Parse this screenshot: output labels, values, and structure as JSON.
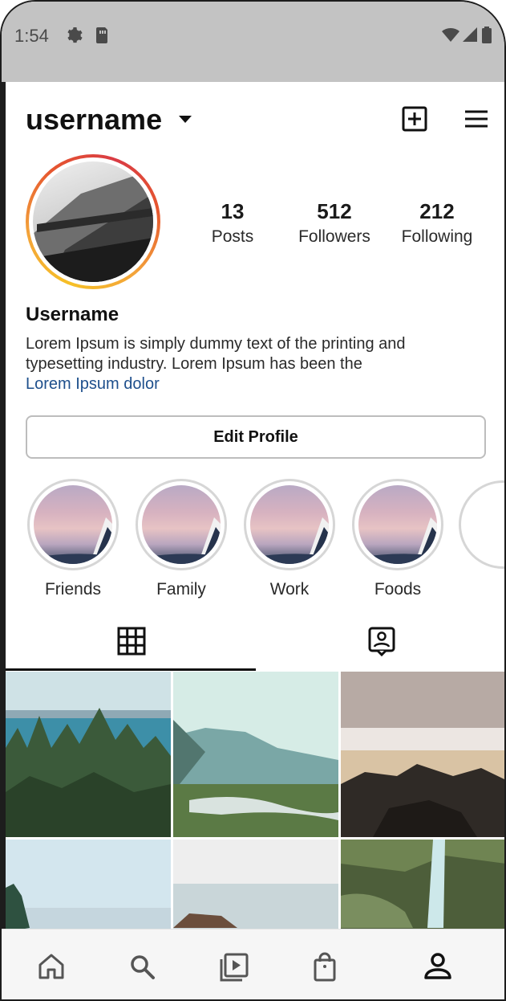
{
  "status_bar": {
    "time": "1:54",
    "icons": [
      "settings-icon",
      "sim-card-icon",
      "wifi-icon",
      "signal-icon",
      "battery-icon"
    ]
  },
  "header": {
    "username": "username",
    "icons": [
      "chevron-down-icon",
      "add-post-icon",
      "menu-icon"
    ]
  },
  "profile": {
    "stats": [
      {
        "value": "13",
        "label": "Posts"
      },
      {
        "value": "512",
        "label": "Followers"
      },
      {
        "value": "212",
        "label": "Following"
      }
    ],
    "display_name": "Username",
    "bio": "Lorem Ipsum is simply dummy text of the printing and typesetting industry. Lorem Ipsum has been the",
    "link": "Lorem Ipsum dolor",
    "edit_button": "Edit Profile"
  },
  "highlights": [
    {
      "label": "Friends"
    },
    {
      "label": "Family"
    },
    {
      "label": "Work"
    },
    {
      "label": "Foods"
    }
  ],
  "tabs": [
    {
      "icon": "grid-icon",
      "active": true
    },
    {
      "icon": "tagged-icon",
      "active": false
    }
  ],
  "bottom_nav": [
    "home-icon",
    "search-icon",
    "reels-icon",
    "shop-icon",
    "profile-icon"
  ],
  "colors": {
    "link": "#1e4f8c",
    "ring_start": "#f6c026",
    "ring_end": "#d93b44",
    "status_bar": "#c3c3c3"
  }
}
